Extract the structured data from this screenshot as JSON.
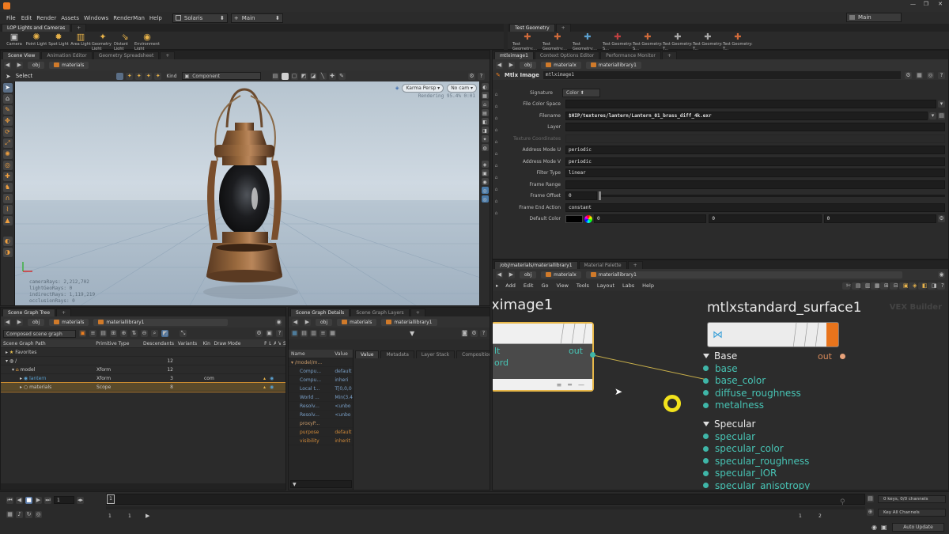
{
  "app": {
    "logo": "houdini-logo-icon"
  },
  "menu": {
    "items": [
      "File",
      "Edit",
      "Render",
      "Assets",
      "Windows",
      "RenderMan",
      "Help"
    ]
  },
  "desktop": {
    "value": "Solaris"
  },
  "context": {
    "value": "Main"
  },
  "top_right": {
    "value": "Main"
  },
  "shelf_left": {
    "tab": "LOP Lights and Cameras",
    "tools": [
      "Camera",
      "Point Light",
      "Spot Light",
      "Area Light",
      "Geometry Light",
      "Distant Light",
      "Environment Light"
    ]
  },
  "shelf_right": {
    "tab": "Test Geometry",
    "tools": [
      "Test Geometry:...",
      "Test Geometry:...",
      "Test Geometry:...",
      "Test Geometry: S...",
      "Test Geometry: S...",
      "Test Geometry: T...",
      "Test Geometry: T...",
      "Test Geometry: T..."
    ]
  },
  "viewport_panel": {
    "tabs": [
      "Scene View",
      "Animation Editor",
      "Geometry Spreadsheet"
    ],
    "path": [
      "obj",
      "materials"
    ],
    "select_label": "Select",
    "kind_label": "Kind",
    "kind_value": "Component",
    "renderer": "Karma Persp",
    "camera": "No cam",
    "render_status": "Rendering  95.4%  0:01",
    "stats": [
      "cameraRays: 2,212,702",
      "lightGeoRays: 0",
      "indirectRays: 1,119,219",
      "occlusionRays: 0"
    ]
  },
  "scene_graph": {
    "tabs": [
      "Scene Graph Tree"
    ],
    "path": [
      "obj",
      "materials",
      "materiallibrary1"
    ],
    "filter": "Composed scene graph",
    "columns": [
      "Scene Graph Path",
      "Primitive Type",
      "Descendants",
      "Variants",
      "Kin",
      "Draw Mode",
      "P",
      "L",
      "A",
      "V",
      "S"
    ],
    "rows": [
      {
        "name": "Favorites",
        "type": "",
        "desc": "",
        "variants": "",
        "kind": "",
        "draw": ""
      },
      {
        "name": "/",
        "type": "",
        "desc": "12",
        "variants": "",
        "kind": "",
        "draw": ""
      },
      {
        "name": "model",
        "type": "Xform",
        "desc": "12",
        "variants": "",
        "kind": "",
        "draw": ""
      },
      {
        "name": "lantern",
        "type": "Xform",
        "desc": "3",
        "variants": "",
        "kind": "com",
        "draw": ""
      },
      {
        "name": "materials",
        "type": "Scope",
        "desc": "8",
        "variants": "",
        "kind": "",
        "draw": ""
      }
    ]
  },
  "sg_details": {
    "tabs": [
      "Scene Graph Details",
      "Scene Graph Layers"
    ],
    "path": [
      "obj",
      "materials",
      "materiallibrary1"
    ],
    "columns": [
      "Name",
      "Value"
    ],
    "value_tabs": [
      "Value",
      "Metadata",
      "Layer Stack",
      "Composition"
    ],
    "rows": [
      {
        "n": "/model/m...",
        "v": ""
      },
      {
        "n": "Compu...",
        "v": "default"
      },
      {
        "n": "Compu...",
        "v": "inheri"
      },
      {
        "n": "Local t...",
        "v": "T[0,0,0"
      },
      {
        "n": "World ...",
        "v": "Min(3.4"
      },
      {
        "n": "Resolv...",
        "v": "<unbo"
      },
      {
        "n": "Resolv...",
        "v": "<unbo"
      },
      {
        "n": "proxyP...",
        "v": ""
      },
      {
        "n": "purpose",
        "v": "default"
      },
      {
        "n": "visibility",
        "v": "inherit"
      }
    ]
  },
  "params": {
    "tabs": [
      "mtlximage1",
      "Context Options Editor",
      "Performance Monitor"
    ],
    "path": [
      "obj",
      "materialx",
      "materiallibrary1"
    ],
    "node_type": "Mtlx Image",
    "node_name": "mtlximage1",
    "rows": [
      {
        "label": "Signature",
        "value": "Color"
      },
      {
        "label": "File Color Space",
        "value": ""
      },
      {
        "label": "Filename",
        "value": "$HIP/textures/lantern/Lantern_01_brass_diff_4k.exr"
      },
      {
        "label": "Layer",
        "value": ""
      },
      {
        "label": "Texture Coordinates",
        "value": ""
      },
      {
        "label": "Address Mode U",
        "value": "periodic"
      },
      {
        "label": "Address Mode V",
        "value": "periodic"
      },
      {
        "label": "Filter Type",
        "value": "linear"
      },
      {
        "label": "Frame Range",
        "value": ""
      },
      {
        "label": "Frame Offset",
        "value": "0"
      },
      {
        "label": "Frame End Action",
        "value": "constant"
      },
      {
        "label": "Default Color",
        "value": "0"
      }
    ],
    "default_color_values": [
      "0",
      "0",
      "0"
    ]
  },
  "network": {
    "tabs": [
      "/obj/materials/materiallibrary1",
      "Material Palette"
    ],
    "path": [
      "obj",
      "materialx",
      "materiallibrary1"
    ],
    "menu": [
      "Add",
      "Edit",
      "Go",
      "View",
      "Tools",
      "Layout",
      "Labs",
      "Help"
    ],
    "builder_tag": "VEX Builder",
    "node_left": {
      "title": "ximage1",
      "out": "out",
      "partial_ports": [
        "lt",
        "ord"
      ]
    },
    "node_right": {
      "title": "mtlxstandard_surface1",
      "out": "out",
      "sections": [
        {
          "name": "Base",
          "ports": [
            "base",
            "base_color",
            "diffuse_roughness",
            "metalness"
          ]
        },
        {
          "name": "Specular",
          "ports": [
            "specular",
            "specular_color",
            "specular_roughness",
            "specular_IOR",
            "specular_anisotropy"
          ]
        }
      ]
    }
  },
  "timeline": {
    "frame_field": "1",
    "start_marker": "1",
    "range_start": "1",
    "range_start2": "1",
    "range_end": "1",
    "range_end2": "2",
    "keys_info": "0 keys, 0/0 channels",
    "key_all": "Key All Channels",
    "auto_update": "Auto Update"
  },
  "colors": {
    "accent": "#f08020",
    "port": "#3fb6a8",
    "wire": "#c9b04a"
  }
}
